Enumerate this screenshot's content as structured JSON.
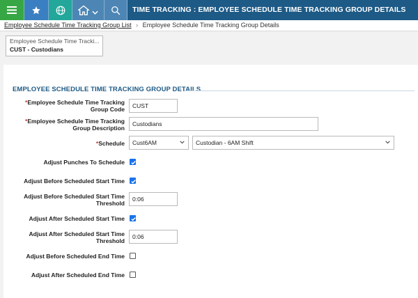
{
  "header": {
    "title": "TIME TRACKING : EMPLOYEE SCHEDULE TIME TRACKING GROUP DETAILS",
    "icons": [
      "menu-icon",
      "star-icon",
      "globe-icon",
      "home-icon",
      "chevron-down-icon",
      "search-icon"
    ]
  },
  "breadcrumb": {
    "link": "Employee Schedule Time Tracking Group List",
    "current": "Employee Schedule Time Tracking Group Details"
  },
  "record_card": {
    "caption": "Employee Schedule Time Tracki...",
    "value": "CUST - Custodians"
  },
  "section": {
    "title": "EMPLOYEE SCHEDULE TIME TRACKING GROUP DETAILS"
  },
  "form": {
    "group_code": {
      "label_line1": "Employee Schedule Time Tracking",
      "label_line2": "Group Code",
      "required": "*",
      "value": "CUST"
    },
    "group_description": {
      "label_line1": "Employee Schedule Time Tracking",
      "label_line2": "Group Description",
      "required": "*",
      "value": "Custodians"
    },
    "schedule": {
      "label": "Schedule",
      "required": "*",
      "code_value": "Cust6AM",
      "name_value": "Custodian - 6AM Shift"
    },
    "adjust_punches": {
      "label": "Adjust Punches To Schedule",
      "checked": true
    },
    "adjust_before_start": {
      "label": "Adjust Before Scheduled Start Time",
      "checked": true
    },
    "adjust_before_start_threshold": {
      "label_line1": "Adjust Before Scheduled Start Time",
      "label_line2": "Threshold",
      "value": "0:06"
    },
    "adjust_after_start": {
      "label": "Adjust After Scheduled Start Time",
      "checked": true
    },
    "adjust_after_start_threshold": {
      "label_line1": "Adjust After Scheduled Start Time",
      "label_line2": "Threshold",
      "value": "0:06"
    },
    "adjust_before_end": {
      "label": "Adjust Before Scheduled End Time",
      "checked": false
    },
    "adjust_after_end": {
      "label": "Adjust After Scheduled End Time",
      "checked": false
    }
  },
  "colors": {
    "header_bg": "#1d5a86",
    "menu_btn": "#37a745",
    "star_btn": "#3a7fc1",
    "globe_btn": "#22a79a",
    "checkbox_checked": "#1a73e8",
    "required_mark": "#c0392b"
  }
}
